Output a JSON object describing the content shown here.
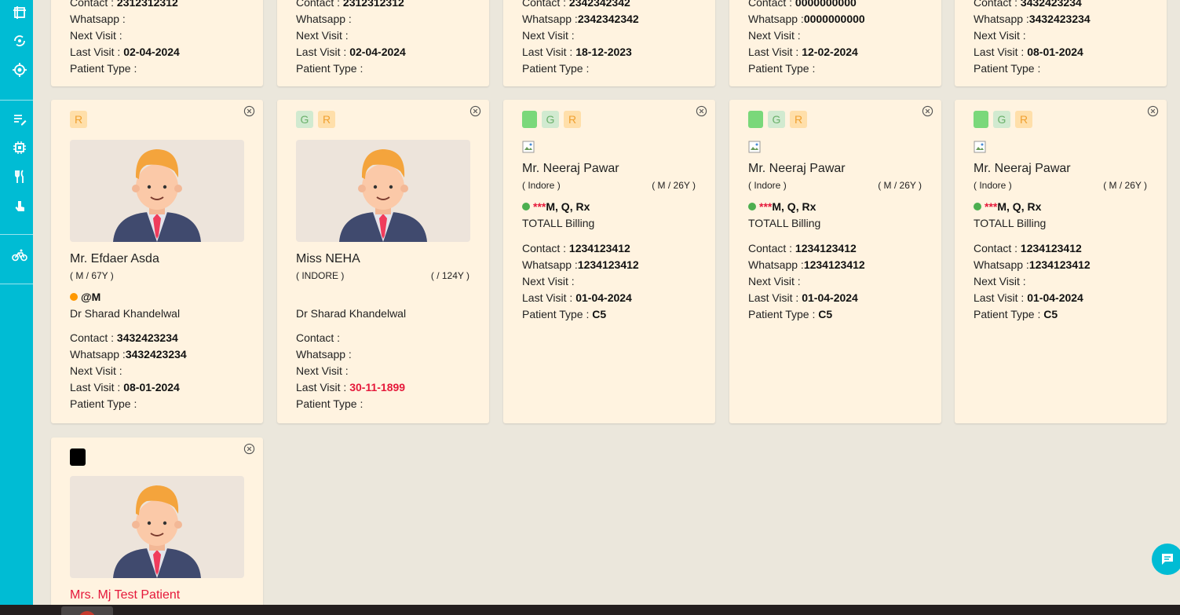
{
  "sidebar": {
    "icons": [
      "grid-icon",
      "sync-icon",
      "target-icon",
      "notes-edit-icon",
      "chip-icon",
      "fork-knife-icon",
      "touch-icon",
      "bicycle-icon"
    ]
  },
  "labels": {
    "contact": "Contact : ",
    "whatsapp": "Whatsapp :",
    "next_visit": "Next Visit : ",
    "last_visit": "Last Visit : ",
    "patient_type": "Patient Type : "
  },
  "top_cards": [
    {
      "contact": "2312312312",
      "whatsapp": "",
      "next_visit": "",
      "last_visit": "02-04-2024",
      "patient_type": ""
    },
    {
      "contact": "2312312312",
      "whatsapp": "",
      "next_visit": "",
      "last_visit": "02-04-2024",
      "patient_type": ""
    },
    {
      "contact": "2342342342",
      "whatsapp": "2342342342",
      "next_visit": "",
      "last_visit": "18-12-2023",
      "patient_type": ""
    },
    {
      "contact": "0000000000",
      "whatsapp": "0000000000",
      "next_visit": "",
      "last_visit": "12-02-2024",
      "patient_type": ""
    },
    {
      "contact": "3432423234",
      "whatsapp": "3432423234",
      "next_visit": "",
      "last_visit": "08-01-2024",
      "patient_type": ""
    }
  ],
  "cards": [
    {
      "badges": [
        "R"
      ],
      "name": "Mr. Efdaer Asda",
      "gender_age": "( M / 67Y )",
      "tag": "@M",
      "doctor": "Dr Sharad Khandelwal",
      "contact": "3432423234",
      "whatsapp": "3432423234",
      "next_visit": "",
      "last_visit": "08-01-2024",
      "patient_type": ""
    },
    {
      "badges": [
        "G",
        "R"
      ],
      "name": "Miss NEHA",
      "city": "( INDORE )",
      "gender_age": "( / 124Y )",
      "doctor": "Dr Sharad Khandelwal",
      "contact": "",
      "whatsapp": "",
      "next_visit": "",
      "last_visit": "30-11-1899",
      "patient_type": ""
    },
    {
      "badges": [
        "",
        "G",
        "R"
      ],
      "name": "Mr. Neeraj Pawar",
      "city": "( Indore )",
      "gender_age": "( M / 26Y )",
      "stars": "***",
      "tags": "M, Q, Rx",
      "billing": "TOTALL Billing",
      "contact": "1234123412",
      "whatsapp": "1234123412",
      "next_visit": "",
      "last_visit": "01-04-2024",
      "patient_type": "C5"
    },
    {
      "badges": [
        "",
        "G",
        "R"
      ],
      "name": "Mr. Neeraj Pawar",
      "city": "( Indore )",
      "gender_age": "( M / 26Y )",
      "stars": "***",
      "tags": "M, Q, Rx",
      "billing": "TOTALL Billing",
      "contact": "1234123412",
      "whatsapp": "1234123412",
      "next_visit": "",
      "last_visit": "01-04-2024",
      "patient_type": "C5"
    },
    {
      "badges": [
        "",
        "G",
        "R"
      ],
      "name": "Mr. Neeraj Pawar",
      "city": "( Indore )",
      "gender_age": "( M / 26Y )",
      "stars": "***",
      "tags": "M, Q, Rx",
      "billing": "TOTALL Billing",
      "contact": "1234123412",
      "whatsapp": "1234123412",
      "next_visit": "",
      "last_visit": "01-04-2024",
      "patient_type": "C5"
    },
    {
      "badges": [
        ""
      ],
      "name": "Mrs. Mj Test Patient"
    }
  ],
  "colors": {
    "sidebar": "#00bcd4",
    "card_bg": "#fff3e0",
    "badge_r_bg": "#ffdfaa",
    "badge_g_bg": "#d1ead0",
    "badge_green": "#7ad87a",
    "dot_green": "#4caf50",
    "dot_orange": "#ff9800",
    "danger": "#e5183a"
  }
}
